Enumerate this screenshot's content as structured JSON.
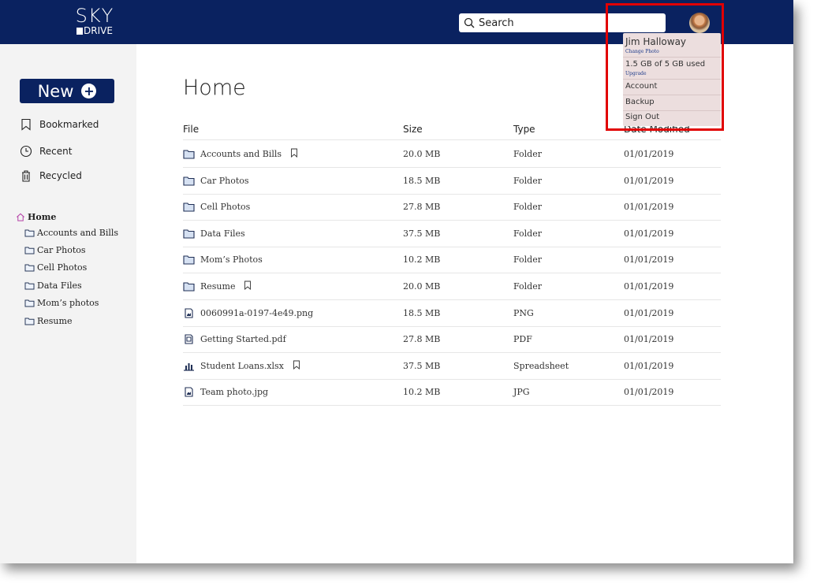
{
  "app": {
    "logo_top": "SKY",
    "logo_bottom": "DRIVE"
  },
  "search": {
    "placeholder": "Search"
  },
  "sidebar": {
    "new_label": "New",
    "nav": [
      {
        "label": "Bookmarked",
        "icon": "bookmark-icon"
      },
      {
        "label": "Recent",
        "icon": "clock-icon"
      },
      {
        "label": "Recycled",
        "icon": "trash-icon"
      }
    ],
    "tree": {
      "root": "Home",
      "children": [
        "Accounts and Bills",
        "Car Photos",
        "Cell Photos",
        "Data Files",
        "Mom’s photos",
        "Resume"
      ]
    }
  },
  "main": {
    "title": "Home",
    "columns": [
      "File",
      "Size",
      "Type",
      "Date Modified"
    ],
    "rows": [
      {
        "name": "Accounts and Bills",
        "icon": "folder-icon",
        "bookmarked": true,
        "size": "20.0 MB",
        "type": "Folder",
        "date": "01/01/2019"
      },
      {
        "name": "Car Photos",
        "icon": "folder-icon",
        "bookmarked": false,
        "size": "18.5 MB",
        "type": "Folder",
        "date": "01/01/2019"
      },
      {
        "name": "Cell Photos",
        "icon": "folder-icon",
        "bookmarked": false,
        "size": "27.8 MB",
        "type": "Folder",
        "date": "01/01/2019"
      },
      {
        "name": "Data Files",
        "icon": "folder-icon",
        "bookmarked": false,
        "size": "37.5 MB",
        "type": "Folder",
        "date": "01/01/2019"
      },
      {
        "name": "Mom’s Photos",
        "icon": "folder-icon",
        "bookmarked": false,
        "size": "10.2 MB",
        "type": "Folder",
        "date": "01/01/2019"
      },
      {
        "name": "Resume",
        "icon": "folder-icon",
        "bookmarked": true,
        "size": "20.0 MB",
        "type": "Folder",
        "date": "01/01/2019"
      },
      {
        "name": "0060991a-0197-4e49.png",
        "icon": "image-file-icon",
        "bookmarked": false,
        "size": "18.5 MB",
        "type": "PNG",
        "date": "01/01/2019"
      },
      {
        "name": "Getting Started.pdf",
        "icon": "pdf-file-icon",
        "bookmarked": false,
        "size": "27.8 MB",
        "type": "PDF",
        "date": "01/01/2019"
      },
      {
        "name": "Student Loans.xlsx",
        "icon": "spreadsheet-icon",
        "bookmarked": true,
        "size": "37.5 MB",
        "type": "Spreadsheet",
        "date": "01/01/2019"
      },
      {
        "name": "Team photo.jpg",
        "icon": "image-file-icon",
        "bookmarked": false,
        "size": "10.2 MB",
        "type": "JPG",
        "date": "01/01/2019"
      }
    ]
  },
  "user_menu": {
    "name": "Jim Halloway",
    "change_photo": "Change Photo",
    "storage": "1.5 GB of 5 GB used",
    "upgrade": "Upgrade",
    "account": "Account",
    "backup": "Backup",
    "sign_out": "Sign Out"
  },
  "colors": {
    "brand": "#0a2260",
    "highlight": "#e10000",
    "menu_bg": "#ecdede"
  }
}
